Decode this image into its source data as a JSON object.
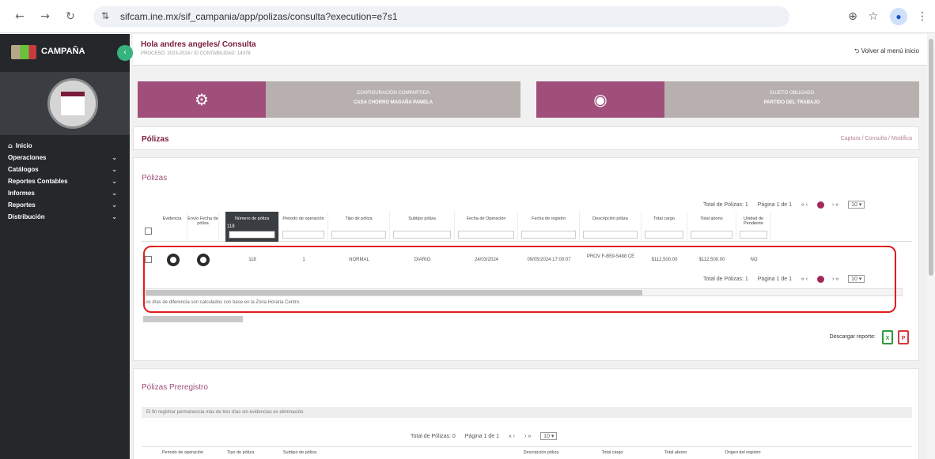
{
  "browser": {
    "url": "sifcam.ine.mx/sif_campania/app/polizas/consulta?execution=e7s1",
    "icons": {
      "back": "arrow-left-icon",
      "forward": "arrow-right-icon",
      "reload": "reload-icon",
      "zoom": "zoom-icon",
      "bookmark": "star-icon",
      "profile": "profile-icon",
      "menu": "kebab-menu-icon"
    }
  },
  "sidebar": {
    "brand": "CAMPAÑA",
    "items": [
      {
        "label": "Inicio",
        "icon": "home-icon"
      },
      {
        "label": "Operaciones"
      },
      {
        "label": "Catálogos"
      },
      {
        "label": "Reportes Contables"
      },
      {
        "label": "Informes"
      },
      {
        "label": "Reportes"
      },
      {
        "label": "Distribución"
      }
    ]
  },
  "header": {
    "greeting": "Hola andres angeles/ Consulta",
    "subtitle": "PROCESO: 2023-2024 / ID CONTABILIDAD: 14378",
    "back_link": "Volver al menú inicio"
  },
  "cards": [
    {
      "icon": "gear-icon",
      "line1": "CONFIGURACIÓN COMPARTIDA",
      "line2": "CASA CHORRO MAGAÑA PAMELA"
    },
    {
      "icon": "user-circle-icon",
      "line1": "SUJETO OBLIGADO",
      "line2": "PARTIDO DEL TRABAJO"
    }
  ],
  "section": {
    "title": "Pólizas",
    "breadcrumbs": "Captura / Consulta / Modifica"
  },
  "polizas": {
    "title": "Pólizas",
    "pager": {
      "total": "Total de Pólizas: 1",
      "page": "Página 1 de 1",
      "nav": "« ‹",
      "nav2": "› »",
      "per_page": "10 ▾"
    },
    "columns": [
      "Evidencia",
      "Envío Fecha de póliza",
      "Número de póliza",
      "Periodo de operación",
      "Tipo de póliza",
      "Subtipo póliza",
      "Fecha de Operación",
      "Fecha de registro",
      "Descripción póliza",
      "Total cargo",
      "Total abono",
      "Unidad de Pendiente"
    ],
    "number_filter": "118",
    "row": {
      "numero": "118",
      "periodo": "1",
      "tipo": "NORMAL",
      "subtipo": "DIARIO",
      "fecha_operacion": "24/03/2024",
      "fecha_registro": "09/05/2024 17:00:07",
      "descripcion": "PROV F-B59-5488 CE",
      "total_cargo": "$112,500.00",
      "total_abono": "$112,500.00",
      "unidad": "NO"
    },
    "note": "Los días de diferencia son calculados con base en la Zona Horaria Centro.",
    "download_label": "Descargar reporte:",
    "download_icons": [
      "excel-icon",
      "pdf-icon"
    ],
    "icon_colors": {
      "excel": "#2e9b3f",
      "pdf": "#d9363e"
    }
  },
  "preregistro": {
    "title": "Pólizas Preregistro",
    "info": "El fin registrar permanencia más de tres días sin evidencias es eliminación.",
    "pager": {
      "total": "Total de Pólizas: 0",
      "page": "Página 1 de 1",
      "nav": "« ‹",
      "nav2": "› »",
      "per_page": "10 ▾"
    },
    "columns": [
      "Periodo de operación",
      "Tipo de póliza",
      "Subtipo de póliza",
      "",
      "",
      "Descripción póliza",
      "Total cargo",
      "Total abono",
      "Origen del registro",
      "",
      ""
    ]
  },
  "colors": {
    "sidebar": "#25282b",
    "brand_accent": "#a04f7b",
    "title": "#7a1b3a",
    "pager_dot": "#a4275a",
    "highlight": "#e11d1d"
  }
}
